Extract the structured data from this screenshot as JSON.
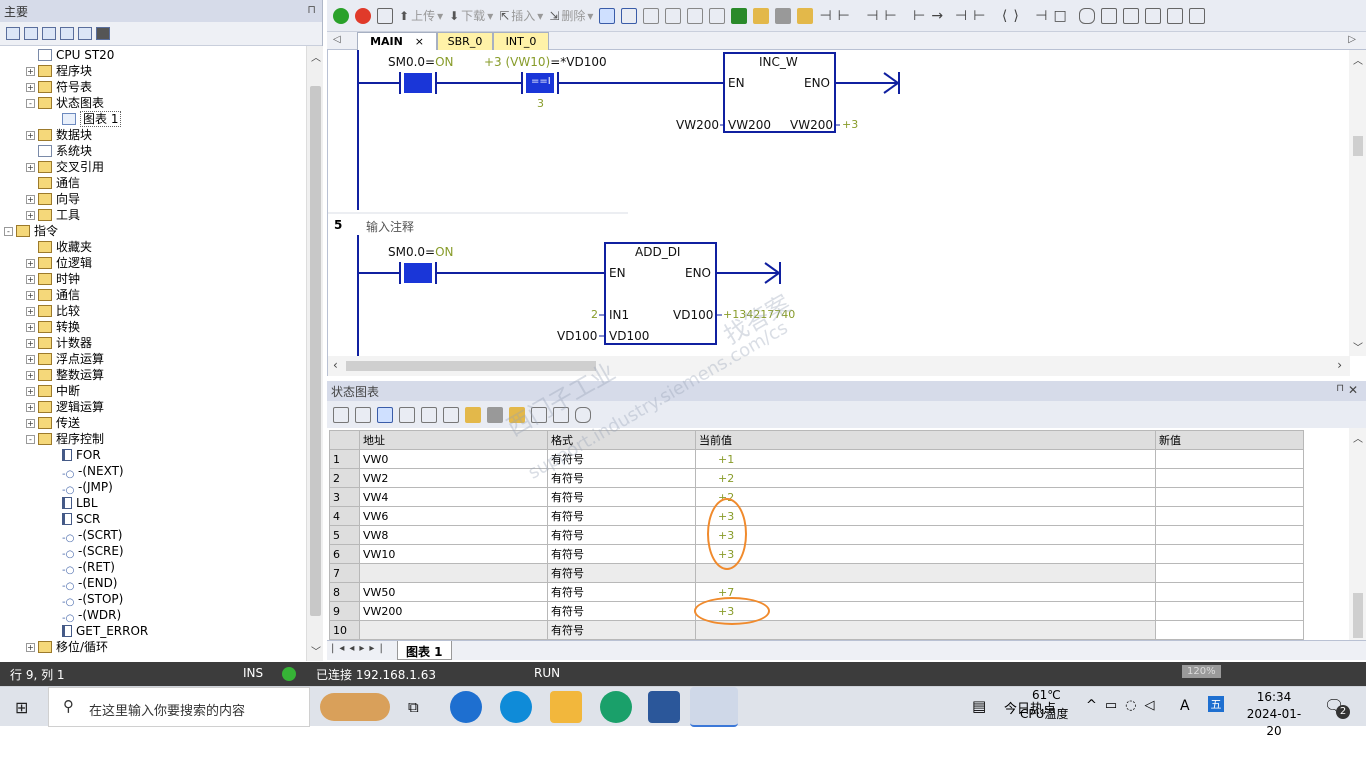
{
  "left_panel": {
    "title": "主要",
    "pin": "⊓",
    "tree": [
      {
        "label": "CPU ST20",
        "depth": 2,
        "icon": "cpu"
      },
      {
        "label": "程序块",
        "depth": 2,
        "icon": "folder",
        "pm": "+"
      },
      {
        "label": "符号表",
        "depth": 2,
        "icon": "folder",
        "pm": "+"
      },
      {
        "label": "状态图表",
        "depth": 2,
        "icon": "folder",
        "pm": "-"
      },
      {
        "label": "图表 1",
        "depth": 3,
        "icon": "grid"
      },
      {
        "label": "数据块",
        "depth": 2,
        "icon": "folder",
        "pm": "+"
      },
      {
        "label": "系统块",
        "depth": 2,
        "icon": "doc"
      },
      {
        "label": "交叉引用",
        "depth": 2,
        "icon": "folder",
        "pm": "+"
      },
      {
        "label": "通信",
        "depth": 2,
        "icon": "comm"
      },
      {
        "label": "向导",
        "depth": 2,
        "icon": "folder",
        "pm": "+"
      },
      {
        "label": "工具",
        "depth": 2,
        "icon": "folder",
        "pm": "+"
      },
      {
        "label": "指令",
        "depth": 1,
        "icon": "folder",
        "pm": "-"
      },
      {
        "label": "收藏夹",
        "depth": 2,
        "icon": "folder"
      },
      {
        "label": "位逻辑",
        "depth": 2,
        "icon": "folder",
        "pm": "+"
      },
      {
        "label": "时钟",
        "depth": 2,
        "icon": "folder",
        "pm": "+"
      },
      {
        "label": "通信",
        "depth": 2,
        "icon": "folder",
        "pm": "+"
      },
      {
        "label": "比较",
        "depth": 2,
        "icon": "folder",
        "pm": "+"
      },
      {
        "label": "转换",
        "depth": 2,
        "icon": "folder",
        "pm": "+"
      },
      {
        "label": "计数器",
        "depth": 2,
        "icon": "folder",
        "pm": "+"
      },
      {
        "label": "浮点运算",
        "depth": 2,
        "icon": "folder",
        "pm": "+"
      },
      {
        "label": "整数运算",
        "depth": 2,
        "icon": "folder",
        "pm": "+"
      },
      {
        "label": "中断",
        "depth": 2,
        "icon": "folder",
        "pm": "+"
      },
      {
        "label": "逻辑运算",
        "depth": 2,
        "icon": "folder",
        "pm": "+"
      },
      {
        "label": "传送",
        "depth": 2,
        "icon": "folder",
        "pm": "+"
      },
      {
        "label": "程序控制",
        "depth": 2,
        "icon": "folder",
        "pm": "-"
      },
      {
        "label": "FOR",
        "depth": 3,
        "icon": "node"
      },
      {
        "label": "-(NEXT)",
        "depth": 3,
        "icon": "coil"
      },
      {
        "label": "-(JMP)",
        "depth": 3,
        "icon": "coil"
      },
      {
        "label": "LBL",
        "depth": 3,
        "icon": "node"
      },
      {
        "label": "SCR",
        "depth": 3,
        "icon": "node"
      },
      {
        "label": "-(SCRT)",
        "depth": 3,
        "icon": "coil"
      },
      {
        "label": "-(SCRE)",
        "depth": 3,
        "icon": "coil"
      },
      {
        "label": "-(RET)",
        "depth": 3,
        "icon": "coil"
      },
      {
        "label": "-(END)",
        "depth": 3,
        "icon": "coil"
      },
      {
        "label": "-(STOP)",
        "depth": 3,
        "icon": "coil"
      },
      {
        "label": "-(WDR)",
        "depth": 3,
        "icon": "coil"
      },
      {
        "label": "GET_ERROR",
        "depth": 3,
        "icon": "node"
      },
      {
        "label": "移位/循环",
        "depth": 2,
        "icon": "folder",
        "pm": "+"
      }
    ]
  },
  "toolbar": {
    "upload": "上传",
    "download": "下载",
    "insert": "插入",
    "delete": "删除"
  },
  "tabs": [
    {
      "label": "MAIN",
      "active": true
    },
    {
      "label": "SBR_0",
      "active": false
    },
    {
      "label": "INT_0",
      "active": false
    }
  ],
  "editor": {
    "net4": {
      "contact1_label": "SM0.0=",
      "contact1_state": "ON",
      "contact2_label_val": "+3 (VW10)",
      "contact2_label_rest": "=*VD100",
      "contact2_op": "==I",
      "contact2_const": "3",
      "box_title": "INC_W",
      "en": "EN",
      "eno": "ENO",
      "in_ext": "VW200",
      "in_pin": "VW200",
      "out_pin": "VW200",
      "out_val": "+3"
    },
    "net5": {
      "number": "5",
      "comment": "输入注释",
      "contact_label": "SM0.0=",
      "contact_state": "ON",
      "box_title": "ADD_DI",
      "en": "EN",
      "eno": "ENO",
      "in1_ext": "2",
      "in1_pin": "IN1",
      "in2_ext": "VD100",
      "in2_pin": "VD100",
      "out_pin": "VD100",
      "out_val": "+134217740"
    }
  },
  "status_chart": {
    "title": "状态图表",
    "headers": [
      "地址",
      "格式",
      "当前值",
      "新值"
    ],
    "rows": [
      {
        "n": "1",
        "addr": "VW0",
        "fmt": "有符号",
        "cur": "+1"
      },
      {
        "n": "2",
        "addr": "VW2",
        "fmt": "有符号",
        "cur": "+2"
      },
      {
        "n": "3",
        "addr": "VW4",
        "fmt": "有符号",
        "cur": "+2"
      },
      {
        "n": "4",
        "addr": "VW6",
        "fmt": "有符号",
        "cur": "+3"
      },
      {
        "n": "5",
        "addr": "VW8",
        "fmt": "有符号",
        "cur": "+3"
      },
      {
        "n": "6",
        "addr": "VW10",
        "fmt": "有符号",
        "cur": "+3"
      },
      {
        "n": "7",
        "addr": "",
        "fmt": "有符号",
        "cur": ""
      },
      {
        "n": "8",
        "addr": "VW50",
        "fmt": "有符号",
        "cur": "+7"
      },
      {
        "n": "9",
        "addr": "VW200",
        "fmt": "有符号",
        "cur": "+3"
      },
      {
        "n": "10",
        "addr": "",
        "fmt": "有符号",
        "cur": ""
      }
    ],
    "sheet_tab": "图表 1"
  },
  "statusbar": {
    "position": "行 9, 列 1",
    "mode": "INS",
    "connection": "已连接 192.168.1.63",
    "run": "RUN",
    "zoom": "120%"
  },
  "taskbar": {
    "search_placeholder": "在这里输入你要搜索的内容",
    "weather_label": "今日热点",
    "temp": "61℃",
    "temp_label": "CPU温度",
    "ime": "A",
    "time": "16:34",
    "date": "2024-01-20",
    "notif_count": "2"
  },
  "watermark": {
    "line1": "西门子工业",
    "line2": "support.industry.siemens.com/cs",
    "line3": "找答案"
  },
  "colors": {
    "accent_blue": "#1020a0",
    "value_olive": "#889c2a",
    "highlight_orange": "#f08a2c",
    "tab_yellow": "#fff2a8",
    "contact_fill": "#1a36d8"
  }
}
